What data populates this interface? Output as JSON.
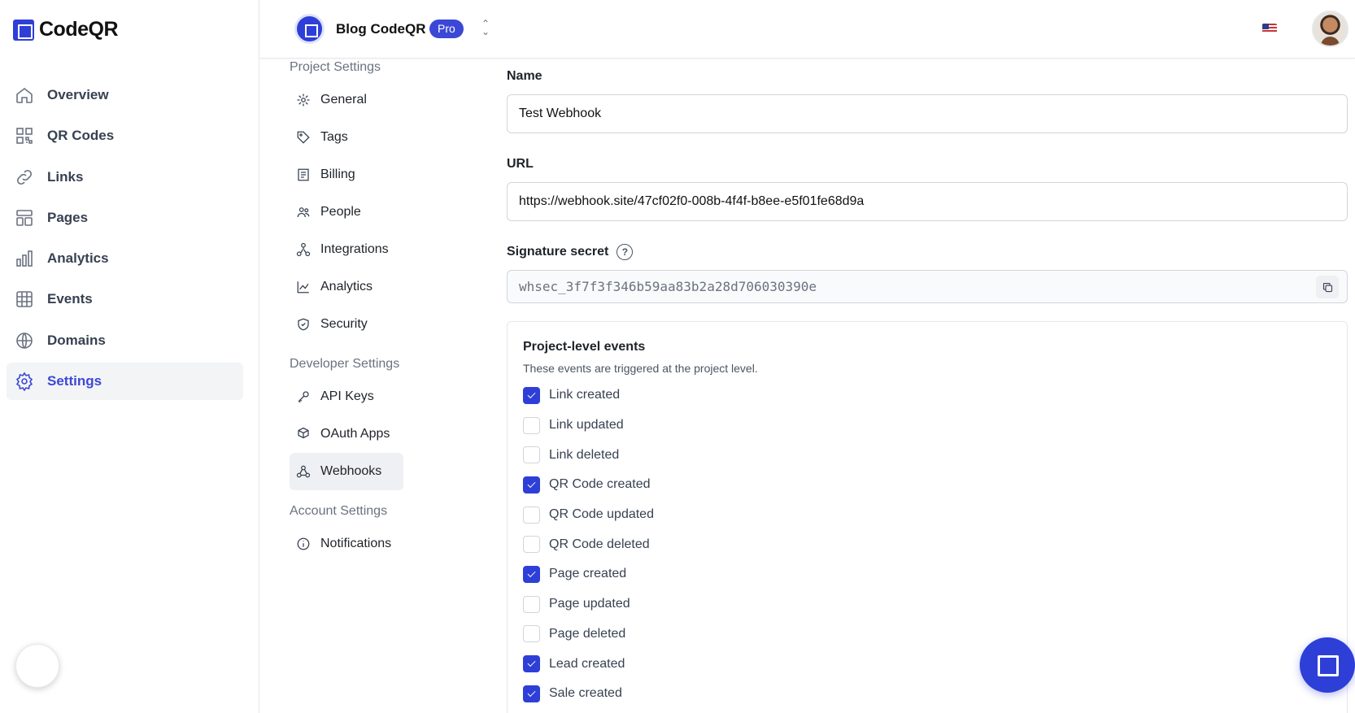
{
  "app": {
    "name": "CodeQR"
  },
  "sidebar": {
    "items": [
      {
        "label": "Overview",
        "icon": "home-icon"
      },
      {
        "label": "QR Codes",
        "icon": "qr-code-icon"
      },
      {
        "label": "Links",
        "icon": "link-icon"
      },
      {
        "label": "Pages",
        "icon": "pages-icon"
      },
      {
        "label": "Analytics",
        "icon": "bar-chart-icon"
      },
      {
        "label": "Events",
        "icon": "table-icon"
      },
      {
        "label": "Domains",
        "icon": "globe-icon"
      },
      {
        "label": "Settings",
        "icon": "gear-icon",
        "active": true
      }
    ]
  },
  "header": {
    "project_name": "Blog CodeQR",
    "plan_badge": "Pro"
  },
  "subnav": {
    "project_heading": "Project Settings",
    "project_items": [
      "General",
      "Tags",
      "Billing",
      "People",
      "Integrations",
      "Analytics",
      "Security"
    ],
    "developer_heading": "Developer Settings",
    "developer_items": [
      "API Keys",
      "OAuth Apps",
      "Webhooks"
    ],
    "account_heading": "Account Settings",
    "account_items": [
      "Notifications"
    ],
    "active": "Webhooks"
  },
  "form": {
    "name_label": "Name",
    "name_value": "Test Webhook",
    "url_label": "URL",
    "url_value": "https://webhook.site/47cf02f0-008b-4f4f-b8ee-e5f01fe68d9a",
    "secret_label": "Signature secret",
    "secret_value": "whsec_3f7f3f346b59aa83b2a28d706030390e"
  },
  "events": {
    "title": "Project-level events",
    "subtitle": "These events are triggered at the project level.",
    "items": [
      {
        "label": "Link created",
        "checked": true
      },
      {
        "label": "Link updated",
        "checked": false
      },
      {
        "label": "Link deleted",
        "checked": false
      },
      {
        "label": "QR Code created",
        "checked": true
      },
      {
        "label": "QR Code updated",
        "checked": false
      },
      {
        "label": "QR Code deleted",
        "checked": false
      },
      {
        "label": "Page created",
        "checked": true
      },
      {
        "label": "Page updated",
        "checked": false
      },
      {
        "label": "Page deleted",
        "checked": false
      },
      {
        "label": "Lead created",
        "checked": true
      },
      {
        "label": "Sale created",
        "checked": true
      }
    ]
  },
  "colors": {
    "accent": "#2e3fd8",
    "active_text": "#3b48d6"
  }
}
